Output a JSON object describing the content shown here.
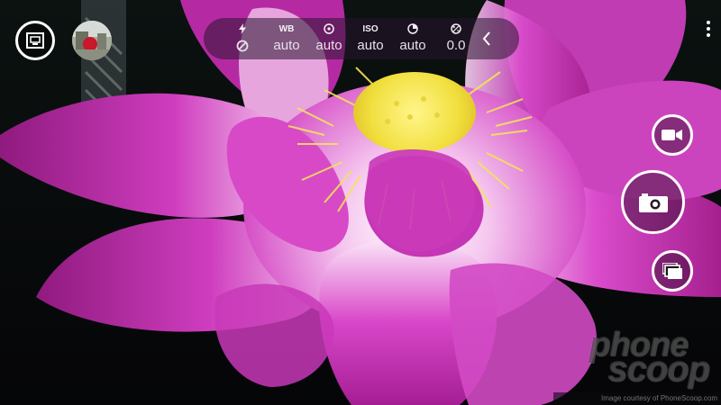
{
  "camera_controls": [
    {
      "id": "flash",
      "icon": "flash-icon",
      "state_icon": "flash-off-icon",
      "value": ""
    },
    {
      "id": "white_balance",
      "label": "WB",
      "value": "auto"
    },
    {
      "id": "focus",
      "icon": "focus-icon",
      "value": "auto"
    },
    {
      "id": "iso",
      "label": "ISO",
      "value": "auto"
    },
    {
      "id": "shutter_speed",
      "icon": "shutter-speed-icon",
      "value": "auto"
    },
    {
      "id": "exposure",
      "icon": "exposure-icon",
      "value": "0.0"
    }
  ],
  "buttons": {
    "lens_switch": "lens-switch-icon",
    "camera_roll": "gallery-thumbnail",
    "more": "more-vertical-icon",
    "video": "video-camera-icon",
    "capture": "camera-icon",
    "burst": "burst-mode-icon",
    "collapse": "chevron-left-icon"
  },
  "watermark": {
    "line1": "phone",
    "line2": "scoop"
  },
  "credit": "Image courtesy of PhoneScoop.com",
  "colors": {
    "petal": "#c93ab8",
    "petal_light": "#f6d3f0",
    "stamen": "#f4e95a",
    "control_text": "#f3eef5"
  }
}
